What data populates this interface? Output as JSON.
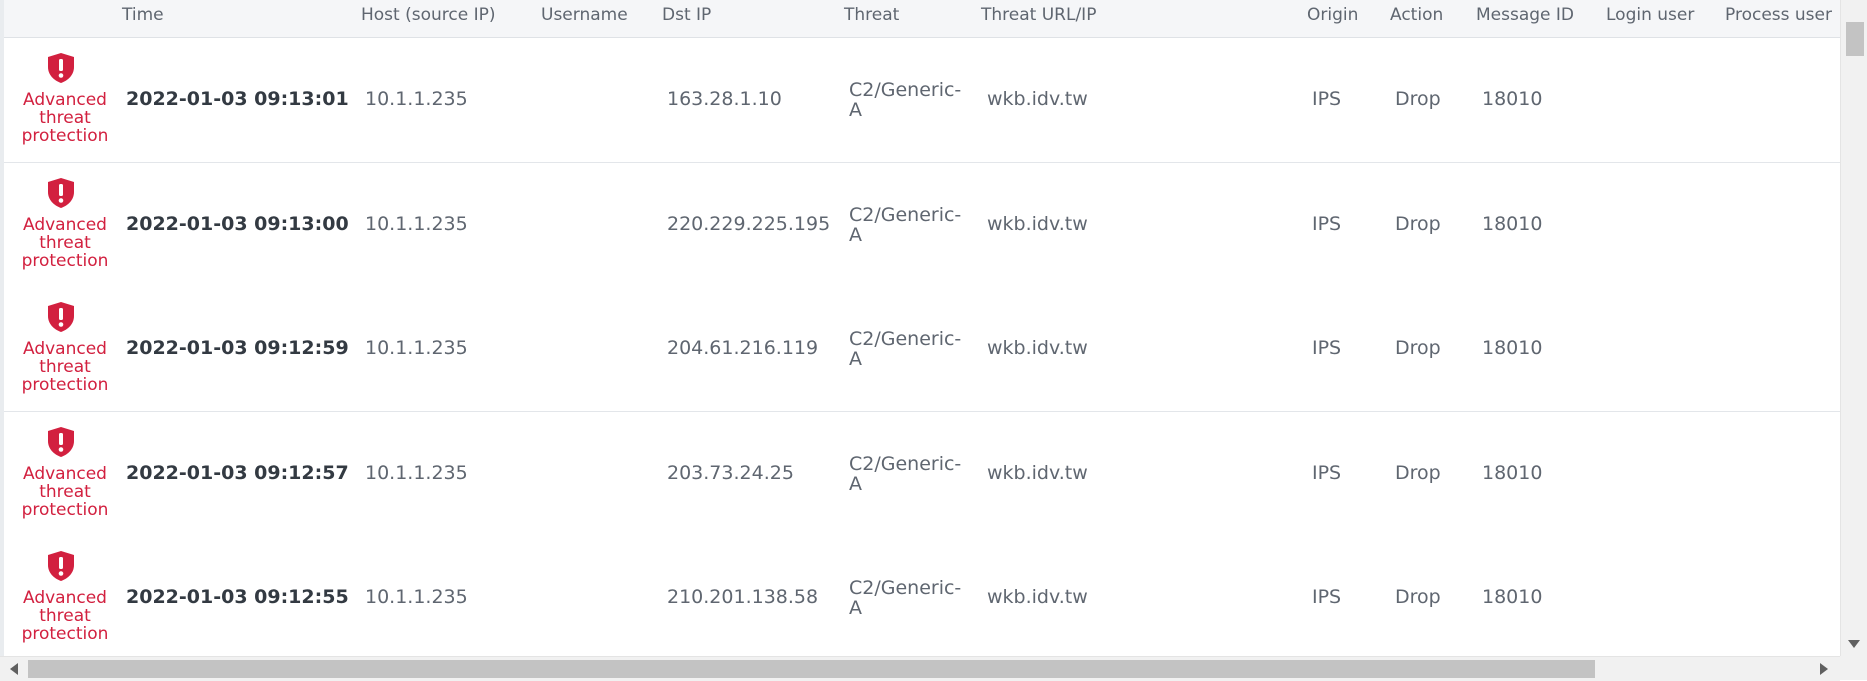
{
  "columns": {
    "time": "Time",
    "host": "Host (source IP)",
    "username": "Username",
    "dst_ip": "Dst IP",
    "threat": "Threat",
    "threat_url": "Threat URL/IP",
    "origin": "Origin",
    "action": "Action",
    "message_id": "Message ID",
    "login_user": "Login user",
    "process_user": "Process user"
  },
  "colors": {
    "category": "#d2203f",
    "header_bg": "#f5f6f8"
  },
  "rows": [
    {
      "icon": "shield-alert-icon",
      "category": "Advanced threat protection",
      "time": "2022-01-03 09:13:01",
      "host": "10.1.1.235",
      "username": "",
      "dst_ip": "163.28.1.10",
      "threat": "C2/Generic-A",
      "threat_url": "wkb.idv.tw",
      "origin": "IPS",
      "action": "Drop",
      "message_id": "18010",
      "login_user": "",
      "process_user": ""
    },
    {
      "icon": "shield-alert-icon",
      "category": "Advanced threat protection",
      "time": "2022-01-03 09:13:00",
      "host": "10.1.1.235",
      "username": "",
      "dst_ip": "220.229.225.195",
      "threat": "C2/Generic-A",
      "threat_url": "wkb.idv.tw",
      "origin": "IPS",
      "action": "Drop",
      "message_id": "18010",
      "login_user": "",
      "process_user": ""
    },
    {
      "icon": "shield-alert-icon",
      "category": "Advanced threat protection",
      "time": "2022-01-03 09:12:59",
      "host": "10.1.1.235",
      "username": "",
      "dst_ip": "204.61.216.119",
      "threat": "C2/Generic-A",
      "threat_url": "wkb.idv.tw",
      "origin": "IPS",
      "action": "Drop",
      "message_id": "18010",
      "login_user": "",
      "process_user": ""
    },
    {
      "icon": "shield-alert-icon",
      "category": "Advanced threat protection",
      "time": "2022-01-03 09:12:57",
      "host": "10.1.1.235",
      "username": "",
      "dst_ip": "203.73.24.25",
      "threat": "C2/Generic-A",
      "threat_url": "wkb.idv.tw",
      "origin": "IPS",
      "action": "Drop",
      "message_id": "18010",
      "login_user": "",
      "process_user": ""
    },
    {
      "icon": "shield-alert-icon",
      "category": "Advanced threat protection",
      "time": "2022-01-03 09:12:55",
      "host": "10.1.1.235",
      "username": "",
      "dst_ip": "210.201.138.58",
      "threat": "C2/Generic-A",
      "threat_url": "wkb.idv.tw",
      "origin": "IPS",
      "action": "Drop",
      "message_id": "18010",
      "login_user": "",
      "process_user": ""
    }
  ]
}
